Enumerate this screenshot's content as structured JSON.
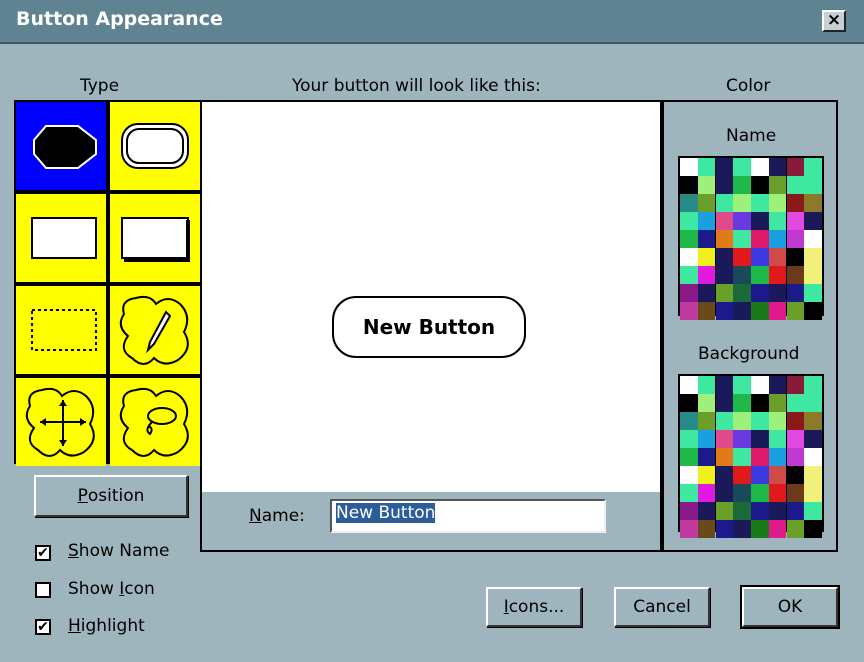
{
  "window": {
    "title": "Button Appearance",
    "close_label": "×"
  },
  "type_panel": {
    "heading": "Type",
    "selected_index": 0
  },
  "preview": {
    "heading": "Your button will look like this:",
    "button_text": "New Button"
  },
  "name_field": {
    "label_prefix": "",
    "label_accel": "N",
    "label_rest": "ame:",
    "value": "New Button"
  },
  "color_panel": {
    "heading": "Color",
    "name_label": "Name",
    "background_label": "Background"
  },
  "position_button": {
    "accel": "P",
    "rest": "osition"
  },
  "checkboxes": [
    {
      "accel": "S",
      "rest": "how Name",
      "checked": true,
      "mark": "✔"
    },
    {
      "pre": "Show ",
      "accel": "I",
      "rest": "con",
      "checked": false,
      "mark": ""
    },
    {
      "accel": "H",
      "rest": "ighlight",
      "checked": true,
      "mark": "✔"
    }
  ],
  "buttons": {
    "icons": {
      "accel": "I",
      "rest": "cons..."
    },
    "cancel": "Cancel",
    "ok": "OK"
  },
  "palette_colors": [
    "#ffffff",
    "#3fe8a0",
    "#1a1a5a",
    "#3fe8a0",
    "#ffffff",
    "#1a1a5a",
    "#8a1a3a",
    "#3fe8a0",
    "#000000",
    "#9ff07a",
    "#1a1a5a",
    "#1fb84a",
    "#000000",
    "#6aa02a",
    "#3fe8a0",
    "#3fe8a0",
    "#2a8a8a",
    "#6aa02a",
    "#3fe8a0",
    "#9ff07a",
    "#3fe8a0",
    "#9ff07a",
    "#8a1a1a",
    "#8a7a2a",
    "#3fe8a0",
    "#1aa0e0",
    "#e04a8a",
    "#6a3ae0",
    "#1a1a5a",
    "#3fe8a0",
    "#e04ae0",
    "#1a1a5a",
    "#1fb84a",
    "#1a1a8a",
    "#e07a1a",
    "#3fe8a0",
    "#e01a6a",
    "#1aa0e0",
    "#c03ad0",
    "#ffffff",
    "#ffffff",
    "#f0f01a",
    "#1a1a5a",
    "#e01a1a",
    "#3a3ae0",
    "#d04a4a",
    "#000000",
    "#f0f07a",
    "#3fe8a0",
    "#e01ae0",
    "#1a1a5a",
    "#1a4a5a",
    "#1fb84a",
    "#e01a1a",
    "#6a3a1a",
    "#f0f07a",
    "#8a1a8a",
    "#1a1a5a",
    "#6aa02a",
    "#1a6a3a",
    "#1a1a8a",
    "#1a1a5a",
    "#1a1a8a",
    "#3fe8a0",
    "#c03aa0",
    "#6a4a1a",
    "#1a1a8a",
    "#1a1a5a",
    "#1a7a1a",
    "#e01a8a",
    "#6aa02a",
    "#000000"
  ]
}
